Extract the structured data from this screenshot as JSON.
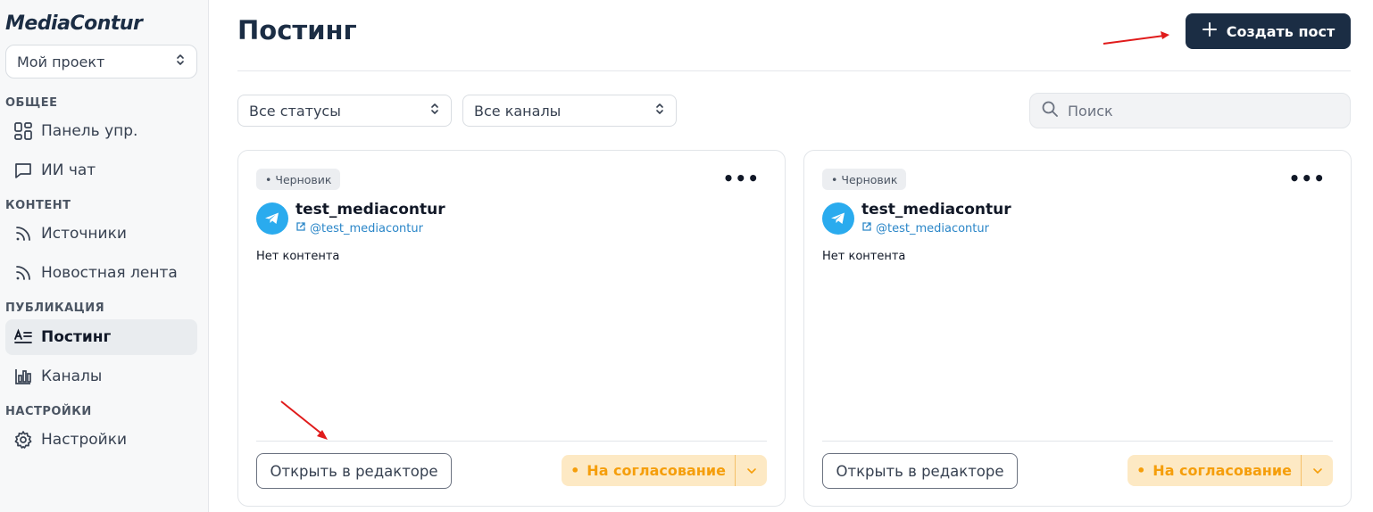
{
  "brand": {
    "logo": "MediaContur"
  },
  "project": {
    "label": "Мой проект"
  },
  "sidebar": {
    "sections": [
      {
        "title": "ОБЩЕЕ"
      },
      {
        "title": "КОНТЕНТ"
      },
      {
        "title": "ПУБЛИКАЦИЯ"
      },
      {
        "title": "НАСТРОЙКИ"
      }
    ],
    "items": [
      {
        "label": "Панель упр.",
        "icon": "dashboard-icon"
      },
      {
        "label": "ИИ чат",
        "icon": "chat-icon"
      },
      {
        "label": "Источники",
        "icon": "rss-icon"
      },
      {
        "label": "Новостная лента",
        "icon": "rss-icon"
      },
      {
        "label": "Постинг",
        "icon": "posting-icon",
        "active": true
      },
      {
        "label": "Каналы",
        "icon": "bar-chart-icon"
      },
      {
        "label": "Настройки",
        "icon": "gear-icon"
      }
    ]
  },
  "header": {
    "title": "Постинг",
    "create_label": "Создать пост"
  },
  "filters": {
    "status": "Все статусы",
    "channels": "Все каналы",
    "search_placeholder": "Поиск"
  },
  "posts": [
    {
      "status": "Черновик",
      "channel_name": "test_mediacontur",
      "channel_handle": "@test_mediacontur",
      "content": "Нет контента",
      "open_label": "Открыть в редакторе",
      "approve_label": "На согласование"
    },
    {
      "status": "Черновик",
      "channel_name": "test_mediacontur",
      "channel_handle": "@test_mediacontur",
      "content": "Нет контента",
      "open_label": "Открыть в редакторе",
      "approve_label": "На согласование"
    }
  ],
  "colors": {
    "brand_dark": "#1b2d44",
    "telegram": "#2aabee",
    "approve_bg": "#fde9c4",
    "approve_text": "#f59e0b",
    "annotation_arrow": "#e01b1b"
  }
}
